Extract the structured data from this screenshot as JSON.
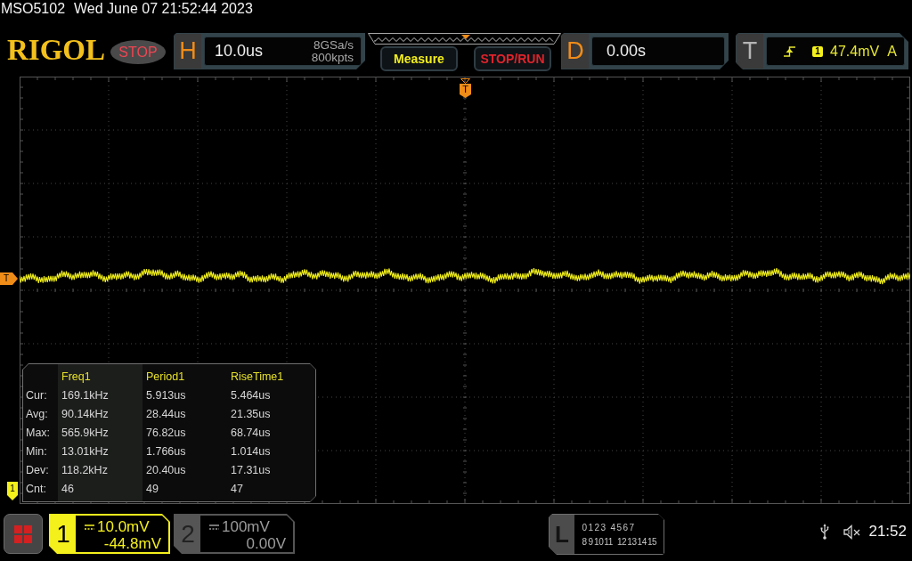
{
  "status_line": {
    "model": "MSO5102",
    "datetime": "Wed June 07 21:52:44 2023"
  },
  "header": {
    "logo": "RIGOL",
    "run_status": {
      "label": "STOP",
      "running": false
    },
    "horizontal": {
      "letter": "H",
      "timebase": "10.0us",
      "sample_rate": "8GSa/s",
      "memory_depth": "800kpts"
    },
    "buttons": [
      {
        "label": "Measure",
        "kind": "measure"
      },
      {
        "label": "STOP/RUN",
        "kind": "run_control"
      }
    ],
    "delay": {
      "letter": "D",
      "value": "0.00s"
    },
    "trigger": {
      "letter": "T",
      "source": "1",
      "reading": "47.4mV",
      "mode": "A"
    }
  },
  "display": {
    "trigger_position_marker": "T",
    "trigger_level_marker": "T",
    "channel_marker": "1",
    "measurements": {
      "row_labels": [
        "Cur:",
        "Avg:",
        "Max:",
        "Min:",
        "Dev:",
        "Cnt:"
      ],
      "columns": [
        {
          "title": "Freq1",
          "selected": true,
          "values": [
            "169.1kHz",
            "90.14kHz",
            "565.9kHz",
            "13.01kHz",
            "118.2kHz",
            "46"
          ]
        },
        {
          "title": "Period1",
          "selected": false,
          "values": [
            "5.913us",
            "28.44us",
            "76.82us",
            "1.766us",
            "20.40us",
            "49"
          ]
        },
        {
          "title": "RiseTime1",
          "selected": false,
          "values": [
            "5.464us",
            "21.35us",
            "68.74us",
            "1.014us",
            "17.31us",
            "47"
          ]
        }
      ]
    }
  },
  "channels": [
    {
      "number": "1",
      "scale": "10.0mV",
      "offset": "-44.8mV",
      "on": true
    },
    {
      "number": "2",
      "scale": "100mV",
      "offset": "0.00V",
      "on": false
    }
  ],
  "logic": {
    "letter": "L",
    "bits": [
      [
        "0",
        "1",
        "2",
        "3",
        "4",
        "5",
        "6",
        "7"
      ],
      [
        "8",
        "9",
        "10",
        "11",
        "12",
        "13",
        "14",
        "15"
      ]
    ]
  },
  "status_bar": {
    "time": "21:52"
  }
}
